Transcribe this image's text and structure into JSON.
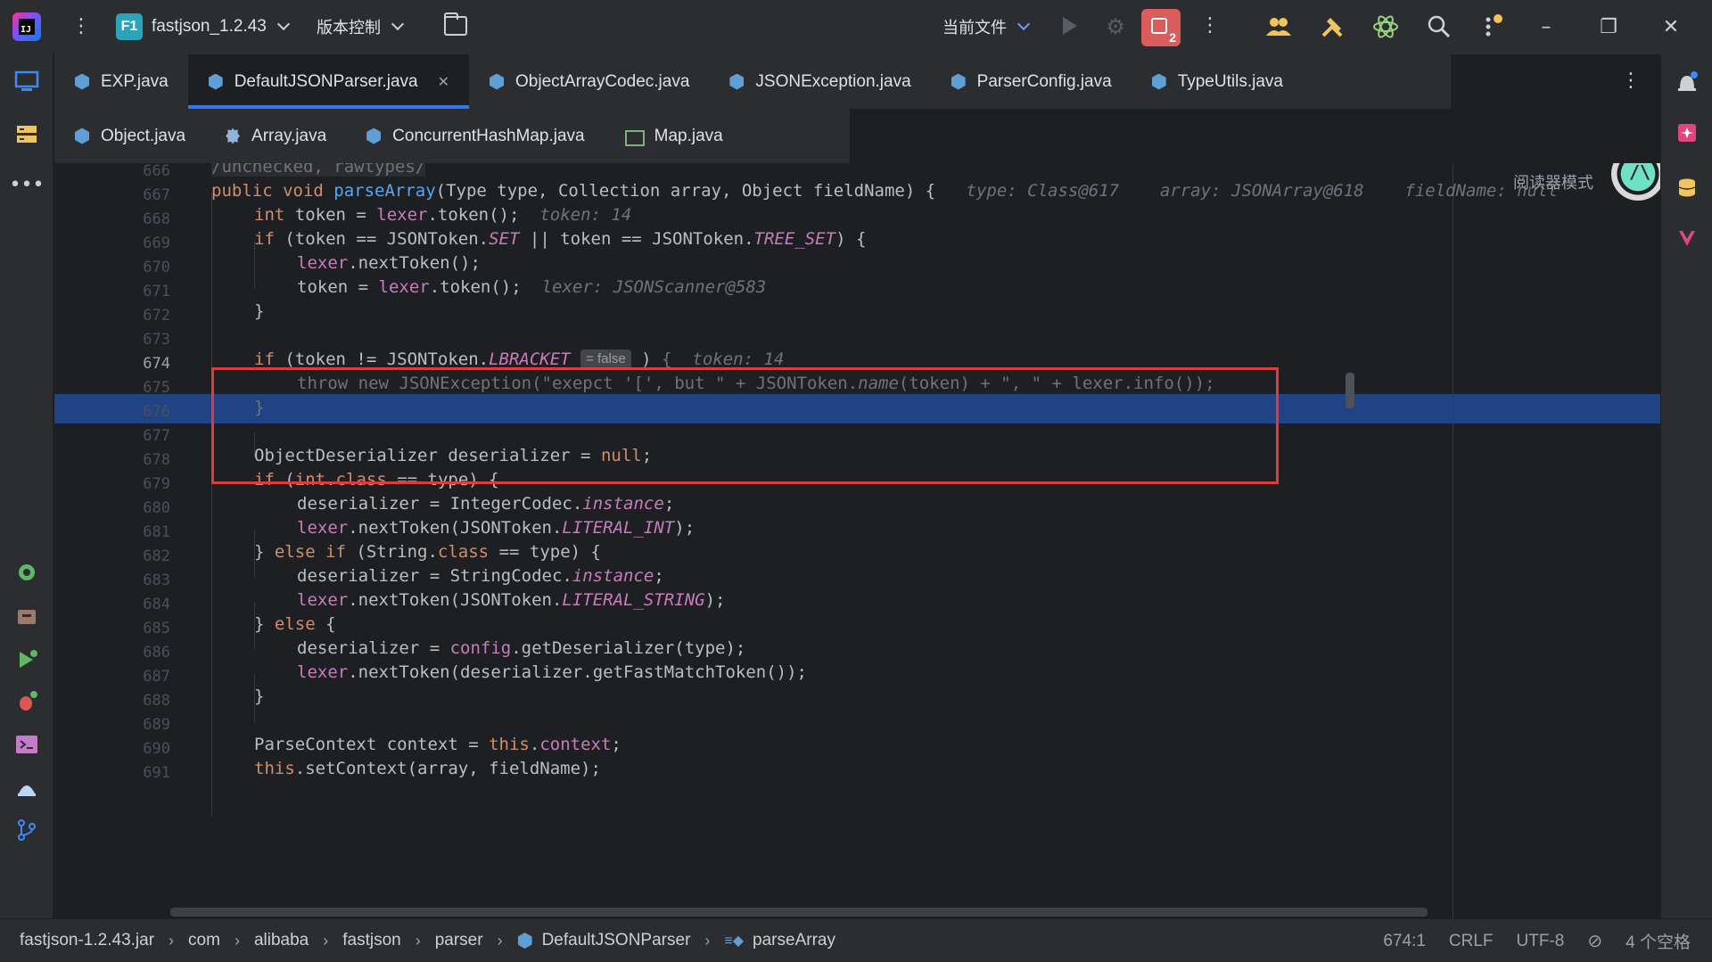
{
  "titlebar": {
    "project_badge": "F1",
    "project_name": "fastjson_1.2.43",
    "vcs_label": "版本控制",
    "run_config": "当前文件",
    "stop_count": "2"
  },
  "tabs_row1": [
    {
      "label": "EXP.java",
      "icon": "java-class-icon"
    },
    {
      "label": "DefaultJSONParser.java",
      "icon": "java-class-icon",
      "active": true
    },
    {
      "label": "ObjectArrayCodec.java",
      "icon": "java-class-icon"
    },
    {
      "label": "JSONException.java",
      "icon": "java-class-icon"
    },
    {
      "label": "ParserConfig.java",
      "icon": "java-class-icon"
    },
    {
      "label": "TypeUtils.java",
      "icon": "java-class-icon"
    }
  ],
  "tabs_row2": [
    {
      "label": "Object.java",
      "icon": "java-class-icon"
    },
    {
      "label": "Array.java",
      "icon": "java-gear-icon"
    },
    {
      "label": "ConcurrentHashMap.java",
      "icon": "java-class-icon"
    },
    {
      "label": "Map.java",
      "icon": "java-structure-icon"
    }
  ],
  "editor": {
    "reader_mode": "阅读器模式",
    "current_line": "674",
    "inlay_false": "= false",
    "lines": [
      {
        "n": "666",
        "text": "/unchecked, rawtypes/"
      },
      {
        "n": "667",
        "text": "public void parseArray(Type type, Collection array, Object fieldName) {",
        "hint": "type: Class@617    array: JSONArray@618    fieldName: null"
      },
      {
        "n": "668",
        "text": "int token = lexer.token();",
        "hint": "token: 14"
      },
      {
        "n": "669",
        "text": "if (token == JSONToken.SET || token == JSONToken.TREE_SET) {"
      },
      {
        "n": "670",
        "text": "lexer.nextToken();"
      },
      {
        "n": "671",
        "text": "token = lexer.token();",
        "hint": "lexer: JSONScanner@583"
      },
      {
        "n": "672",
        "text": "}"
      },
      {
        "n": "673",
        "text": ""
      },
      {
        "n": "674",
        "text": "if (token != JSONToken.LBRACKET) {",
        "hint": "token: 14"
      },
      {
        "n": "675",
        "text": "throw new JSONException(\"exepct '[', but \" + JSONToken.name(token) + \", \" + lexer.info());"
      },
      {
        "n": "676",
        "text": "}"
      },
      {
        "n": "677",
        "text": ""
      },
      {
        "n": "678",
        "text": "ObjectDeserializer deserializer = null;"
      },
      {
        "n": "679",
        "text": "if (int.class == type) {"
      },
      {
        "n": "680",
        "text": "deserializer = IntegerCodec.instance;"
      },
      {
        "n": "681",
        "text": "lexer.nextToken(JSONToken.LITERAL_INT);"
      },
      {
        "n": "682",
        "text": "} else if (String.class == type) {"
      },
      {
        "n": "683",
        "text": "deserializer = StringCodec.instance;"
      },
      {
        "n": "684",
        "text": "lexer.nextToken(JSONToken.LITERAL_STRING);"
      },
      {
        "n": "685",
        "text": "} else {"
      },
      {
        "n": "686",
        "text": "deserializer = config.getDeserializer(type);"
      },
      {
        "n": "687",
        "text": "lexer.nextToken(deserializer.getFastMatchToken());"
      },
      {
        "n": "688",
        "text": "}"
      },
      {
        "n": "689",
        "text": ""
      },
      {
        "n": "690",
        "text": "ParseContext context = this.context;"
      },
      {
        "n": "691",
        "text": "this.setContext(array, fieldName);"
      }
    ]
  },
  "statusbar": {
    "breadcrumbs": [
      "fastjson-1.2.43.jar",
      "com",
      "alibaba",
      "fastjson",
      "parser",
      "DefaultJSONParser",
      "parseArray"
    ],
    "position": "674:1",
    "line_sep": "CRLF",
    "encoding": "UTF-8",
    "indent": "4 个空格"
  },
  "colors": {
    "accent": "#3574f0",
    "selection": "#214283",
    "highlight_box": "#e03a3a",
    "keyword": "#cf8e6d",
    "static_field": "#c77dbb",
    "method": "#56a8f5"
  }
}
